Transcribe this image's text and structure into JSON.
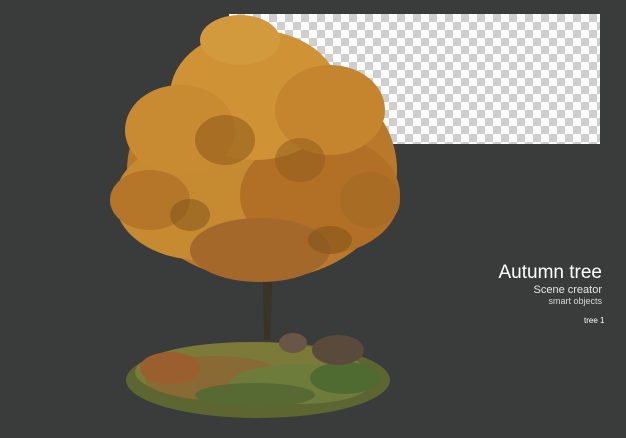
{
  "caption": {
    "title": "Autumn tree",
    "subtitle": "Scene creator",
    "subtitle2": "smart objects"
  },
  "tag": "tree 1",
  "colors": {
    "background": "#3a3b3b",
    "foliage": "#c9882c",
    "foliage_dark": "#8e5a1a",
    "grass": "#6f7a3a",
    "text": "#ffffff"
  }
}
